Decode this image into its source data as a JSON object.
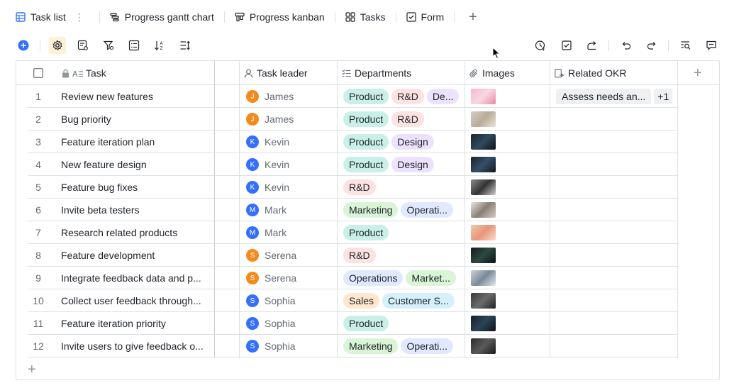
{
  "tabs": [
    {
      "label": "Task list",
      "icon": "table-icon",
      "active": true
    },
    {
      "label": "Progress gantt chart",
      "icon": "gantt-icon"
    },
    {
      "label": "Progress kanban",
      "icon": "kanban-icon"
    },
    {
      "label": "Tasks",
      "icon": "grid-icon"
    },
    {
      "label": "Form",
      "icon": "form-icon"
    }
  ],
  "more_dots": "⋮",
  "add_tab": "+",
  "colors": {
    "accent": "#3370ff",
    "border": "#dee0e3",
    "tag_product": "#c8f0e8",
    "tag_rnd": "#fde2e2",
    "tag_design": "#ece2fe",
    "tag_marketing": "#d9f5d6",
    "tag_operations": "#e0e9ff",
    "tag_sales": "#fee7cd",
    "tag_customer": "#d4f0fa"
  },
  "headers": {
    "task": "Task",
    "leader": "Task leader",
    "departments": "Departments",
    "images": "Images",
    "okr": "Related OKR",
    "add_column": "+"
  },
  "rows": [
    {
      "num": "1",
      "task": "Review new features",
      "leader": "James",
      "initial": "J",
      "avatar_color": "#f28b1b",
      "depts": [
        [
          "Product",
          "#c8f0e8",
          null
        ],
        [
          "R&D",
          "#fde2e2",
          null
        ],
        [
          "De...",
          "#ece2fe",
          null
        ]
      ],
      "img": "linear-gradient(135deg,#f6b7c8,#f9d8e2,#e48aa5)",
      "okr": [
        "Assess needs an...",
        "+1"
      ]
    },
    {
      "num": "2",
      "task": "Bug priority",
      "leader": "James",
      "initial": "J",
      "avatar_color": "#f28b1b",
      "depts": [
        [
          "Product",
          "#c8f0e8",
          null
        ],
        [
          "R&D",
          "#fde2e2",
          null
        ]
      ],
      "img": "linear-gradient(135deg,#d8cfc2,#b9ab98,#e9e3da)",
      "okr": []
    },
    {
      "num": "3",
      "task": "Feature iteration plan",
      "leader": "Kevin",
      "initial": "K",
      "avatar_color": "#3370ff",
      "depts": [
        [
          "Product",
          "#c8f0e8",
          null
        ],
        [
          "Design",
          "#ece2fe",
          null
        ]
      ],
      "img": "linear-gradient(135deg,#1c2430,#2f4a5e,#0f1418)",
      "okr": []
    },
    {
      "num": "4",
      "task": "New feature design",
      "leader": "Kevin",
      "initial": "K",
      "avatar_color": "#3370ff",
      "depts": [
        [
          "Product",
          "#c8f0e8",
          null
        ],
        [
          "Design",
          "#ece2fe",
          null
        ]
      ],
      "img": "linear-gradient(135deg,#1a222c,#35506a,#11171d)",
      "okr": []
    },
    {
      "num": "5",
      "task": "Feature bug fixes",
      "leader": "Kevin",
      "initial": "K",
      "avatar_color": "#3370ff",
      "depts": [
        [
          "R&D",
          "#fde2e2",
          null
        ]
      ],
      "img": "linear-gradient(135deg,#8a8a8a,#333,#cfcfcf)",
      "okr": []
    },
    {
      "num": "6",
      "task": "Invite beta testers",
      "leader": "Mark",
      "initial": "M",
      "avatar_color": "#3370ff",
      "depts": [
        [
          "Marketing",
          "#d9f5d6",
          null
        ],
        [
          "Operati...",
          "#e0e9ff",
          null
        ]
      ],
      "img": "linear-gradient(135deg,#e9e6e2,#8a7f75,#d4ccc3)",
      "okr": []
    },
    {
      "num": "7",
      "task": "Research related products",
      "leader": "Mark",
      "initial": "M",
      "avatar_color": "#3370ff",
      "depts": [
        [
          "Product",
          "#c8f0e8",
          null
        ]
      ],
      "img": "linear-gradient(135deg,#f1c7a8,#e9967a,#f5dccb)",
      "okr": []
    },
    {
      "num": "8",
      "task": "Feature development",
      "leader": "Serena",
      "initial": "S",
      "avatar_color": "#f28b1b",
      "depts": [
        [
          "R&D",
          "#fde2e2",
          null
        ]
      ],
      "img": "linear-gradient(135deg,#141b22,#2e4a3f,#0d1217)",
      "okr": []
    },
    {
      "num": "9",
      "task": "Integrate feedback data and p...",
      "leader": "Serena",
      "initial": "S",
      "avatar_color": "#f28b1b",
      "depts": [
        [
          "Operations",
          "#e0e9ff",
          null
        ],
        [
          "Market...",
          "#d9f5d6",
          null
        ]
      ],
      "img": "linear-gradient(135deg,#c9d3dc,#7b8a99,#e3e8ec)",
      "okr": []
    },
    {
      "num": "10",
      "task": "Collect user feedback through...",
      "leader": "Sophia",
      "initial": "S",
      "avatar_color": "#3370ff",
      "depts": [
        [
          "Sales",
          "#fee7cd",
          null
        ],
        [
          "Customer S...",
          "#d4f0fa",
          null
        ]
      ],
      "img": "linear-gradient(135deg,#3a3a3a,#6b6b6b,#222)",
      "okr": []
    },
    {
      "num": "11",
      "task": "Feature iteration priority",
      "leader": "Sophia",
      "initial": "S",
      "avatar_color": "#3370ff",
      "depts": [
        [
          "Product",
          "#c8f0e8",
          null
        ]
      ],
      "img": "linear-gradient(135deg,#18202a,#2c4457,#0e1318)",
      "okr": []
    },
    {
      "num": "12",
      "task": "Invite users to give feedback o...",
      "leader": "Sophia",
      "initial": "S",
      "avatar_color": "#3370ff",
      "depts": [
        [
          "Marketing",
          "#d9f5d6",
          null
        ],
        [
          "Operati...",
          "#e0e9ff",
          null
        ]
      ],
      "img": "linear-gradient(135deg,#2d2d2d,#5a5a5a,#1a1a1a)",
      "okr": []
    }
  ],
  "add_row": "+"
}
